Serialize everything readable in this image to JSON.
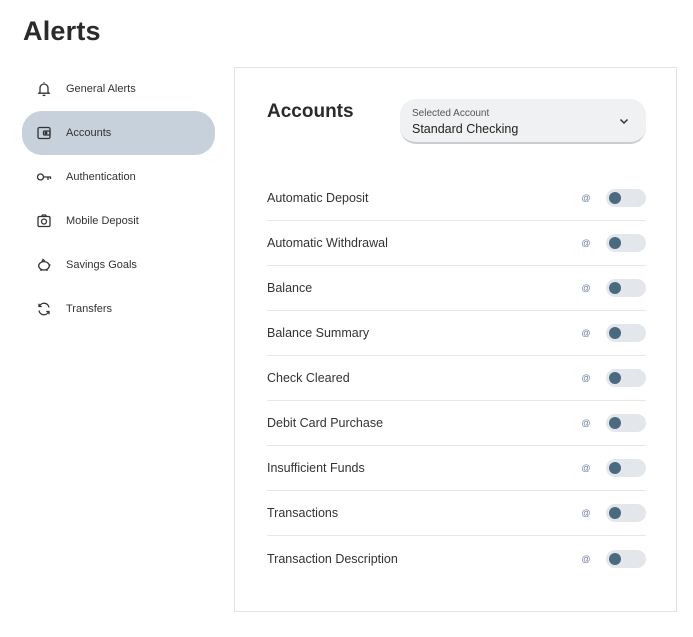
{
  "page": {
    "title": "Alerts"
  },
  "sidebar": {
    "items": [
      {
        "label": "General Alerts",
        "icon": "bell-icon"
      },
      {
        "label": "Accounts",
        "icon": "wallet-icon",
        "active": true
      },
      {
        "label": "Authentication",
        "icon": "key-icon"
      },
      {
        "label": "Mobile Deposit",
        "icon": "camera-icon"
      },
      {
        "label": "Savings Goals",
        "icon": "piggy-bank-icon"
      },
      {
        "label": "Transfers",
        "icon": "transfer-icon"
      }
    ]
  },
  "panel": {
    "title": "Accounts",
    "account_select": {
      "label": "Selected Account",
      "value": "Standard Checking"
    },
    "alerts": [
      {
        "label": "Automatic Deposit",
        "channel": "@",
        "enabled": false
      },
      {
        "label": "Automatic Withdrawal",
        "channel": "@",
        "enabled": false
      },
      {
        "label": "Balance",
        "channel": "@",
        "enabled": false
      },
      {
        "label": "Balance Summary",
        "channel": "@",
        "enabled": false
      },
      {
        "label": "Check Cleared",
        "channel": "@",
        "enabled": false
      },
      {
        "label": "Debit Card Purchase",
        "channel": "@",
        "enabled": false
      },
      {
        "label": "Insufficient Funds",
        "channel": "@",
        "enabled": false
      },
      {
        "label": "Transactions",
        "channel": "@",
        "enabled": false
      },
      {
        "label": "Transaction Description",
        "channel": "@",
        "enabled": false
      }
    ]
  },
  "colors": {
    "active_nav": "#c6d1db",
    "toggle_track": "#e3e7eb",
    "toggle_knob": "#4a6a80"
  }
}
